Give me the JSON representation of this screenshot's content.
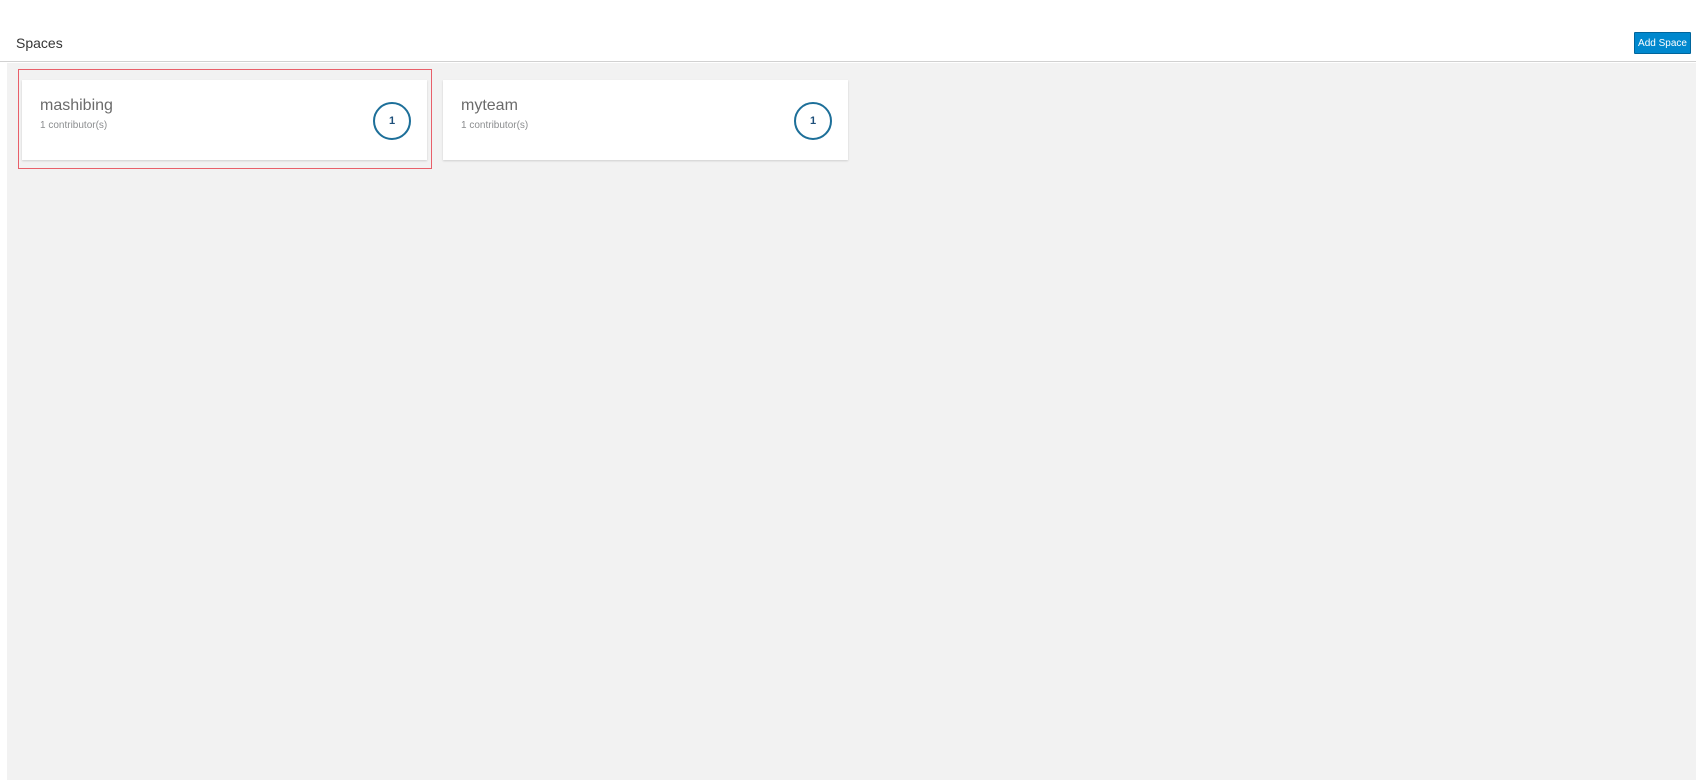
{
  "header": {
    "title": "Spaces",
    "add_button_label": "Add Space"
  },
  "colors": {
    "accent": "#0088ce",
    "badge_border": "#1d6f99",
    "selection_outline": "#e8606a",
    "content_background": "#f2f2f2"
  },
  "spaces": [
    {
      "name": "mashibing",
      "contributors": "1 contributor(s)",
      "count": "1",
      "highlighted": true
    },
    {
      "name": "myteam",
      "contributors": "1 contributor(s)",
      "count": "1",
      "highlighted": false
    }
  ]
}
